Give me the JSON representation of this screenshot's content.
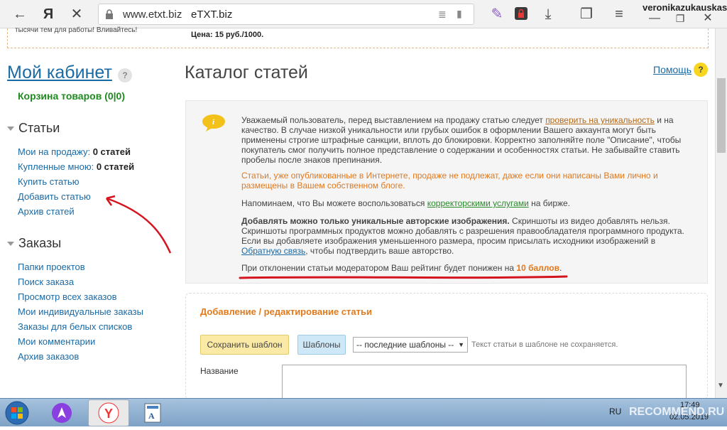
{
  "browser": {
    "url_host": "www.etxt.biz",
    "tab_title": "eTXT.biz",
    "user": "veronikazukauskas"
  },
  "strip": {
    "left_text": "тысячи тем для работы! Вливайтесь!",
    "price": "Цена: 15 руб./1000."
  },
  "sidebar": {
    "title": "Мой кабинет",
    "help_mark": "?",
    "cart": "Корзина товаров (0|0)",
    "articles_heading": "Статьи",
    "articles": [
      {
        "label": "Мои на продажу:",
        "count": "0 статей"
      },
      {
        "label": "Купленные мною:",
        "count": "0 статей"
      },
      {
        "label": "Купить статью"
      },
      {
        "label": "Добавить статью"
      },
      {
        "label": "Архив статей"
      }
    ],
    "orders_heading": "Заказы",
    "orders": [
      "Папки проектов",
      "Поиск заказа",
      "Просмотр всех заказов",
      "Мои индивидуальные заказы",
      "Заказы для белых списков",
      "Мои комментарии",
      "Архив заказов"
    ]
  },
  "main": {
    "title": "Каталог статей",
    "help": "Помощь",
    "help_mark": "?",
    "info": {
      "p1_a": "Уважаемый пользователь, перед выставлением на продажу статью следует ",
      "p1_link": "проверить на уникальность",
      "p1_b": " и на качество. В случае низкой уникальности или грубых ошибок в оформлении Вашего аккаунта могут быть применены строгие штрафные санкции, вплоть до блокировки. Корректно заполняйте поле \"Описание\", чтобы покупатель смог получить полное представление о содержании и особенностях статьи. Не забывайте ставить пробелы после знаков препинания.",
      "p2": "Статьи, уже опубликованные в Интернете, продаже не подлежат, даже если они написаны Вами лично и размещены в Вашем собственном блоге.",
      "p3_a": "Напоминаем, что Вы можете воспользоваться ",
      "p3_link": "корректорскими услугами",
      "p3_b": " на бирже.",
      "p4_bold": "Добавлять можно только уникальные авторские изображения.",
      "p4_a": " Скриншоты из видео добавлять нельзя. Скриншоты программных продуктов можно добавлять с разрешения правообладателя программного продукта. Если вы добавляете изображения уменьшенного размера, просим присылать исходники изображений в ",
      "p4_link": "Обратную связь",
      "p4_b": ", чтобы подтвердить ваше авторство.",
      "p5_a": "При отклонении статьи модератором Ваш рейтинг будет понижен на ",
      "p5_bold": "10 баллов",
      "p5_b": "."
    },
    "form": {
      "title": "Добавление / редактирование статьи",
      "save_template": "Сохранить шаблон",
      "templates": "Шаблоны",
      "select_value": "-- последние шаблоны --",
      "template_note": "Текст статьи в шаблоне не сохраняется.",
      "name_label": "Название"
    }
  },
  "taskbar": {
    "lang": "RU",
    "time": "17:49",
    "date": "02.05.2019",
    "watermark": "RECOMMEND.RU"
  },
  "colors": {
    "link": "#1a6aa5",
    "cart_green": "#1f8a1f",
    "warning_orange": "#e0781d",
    "annotation_red": "#d4141e"
  }
}
